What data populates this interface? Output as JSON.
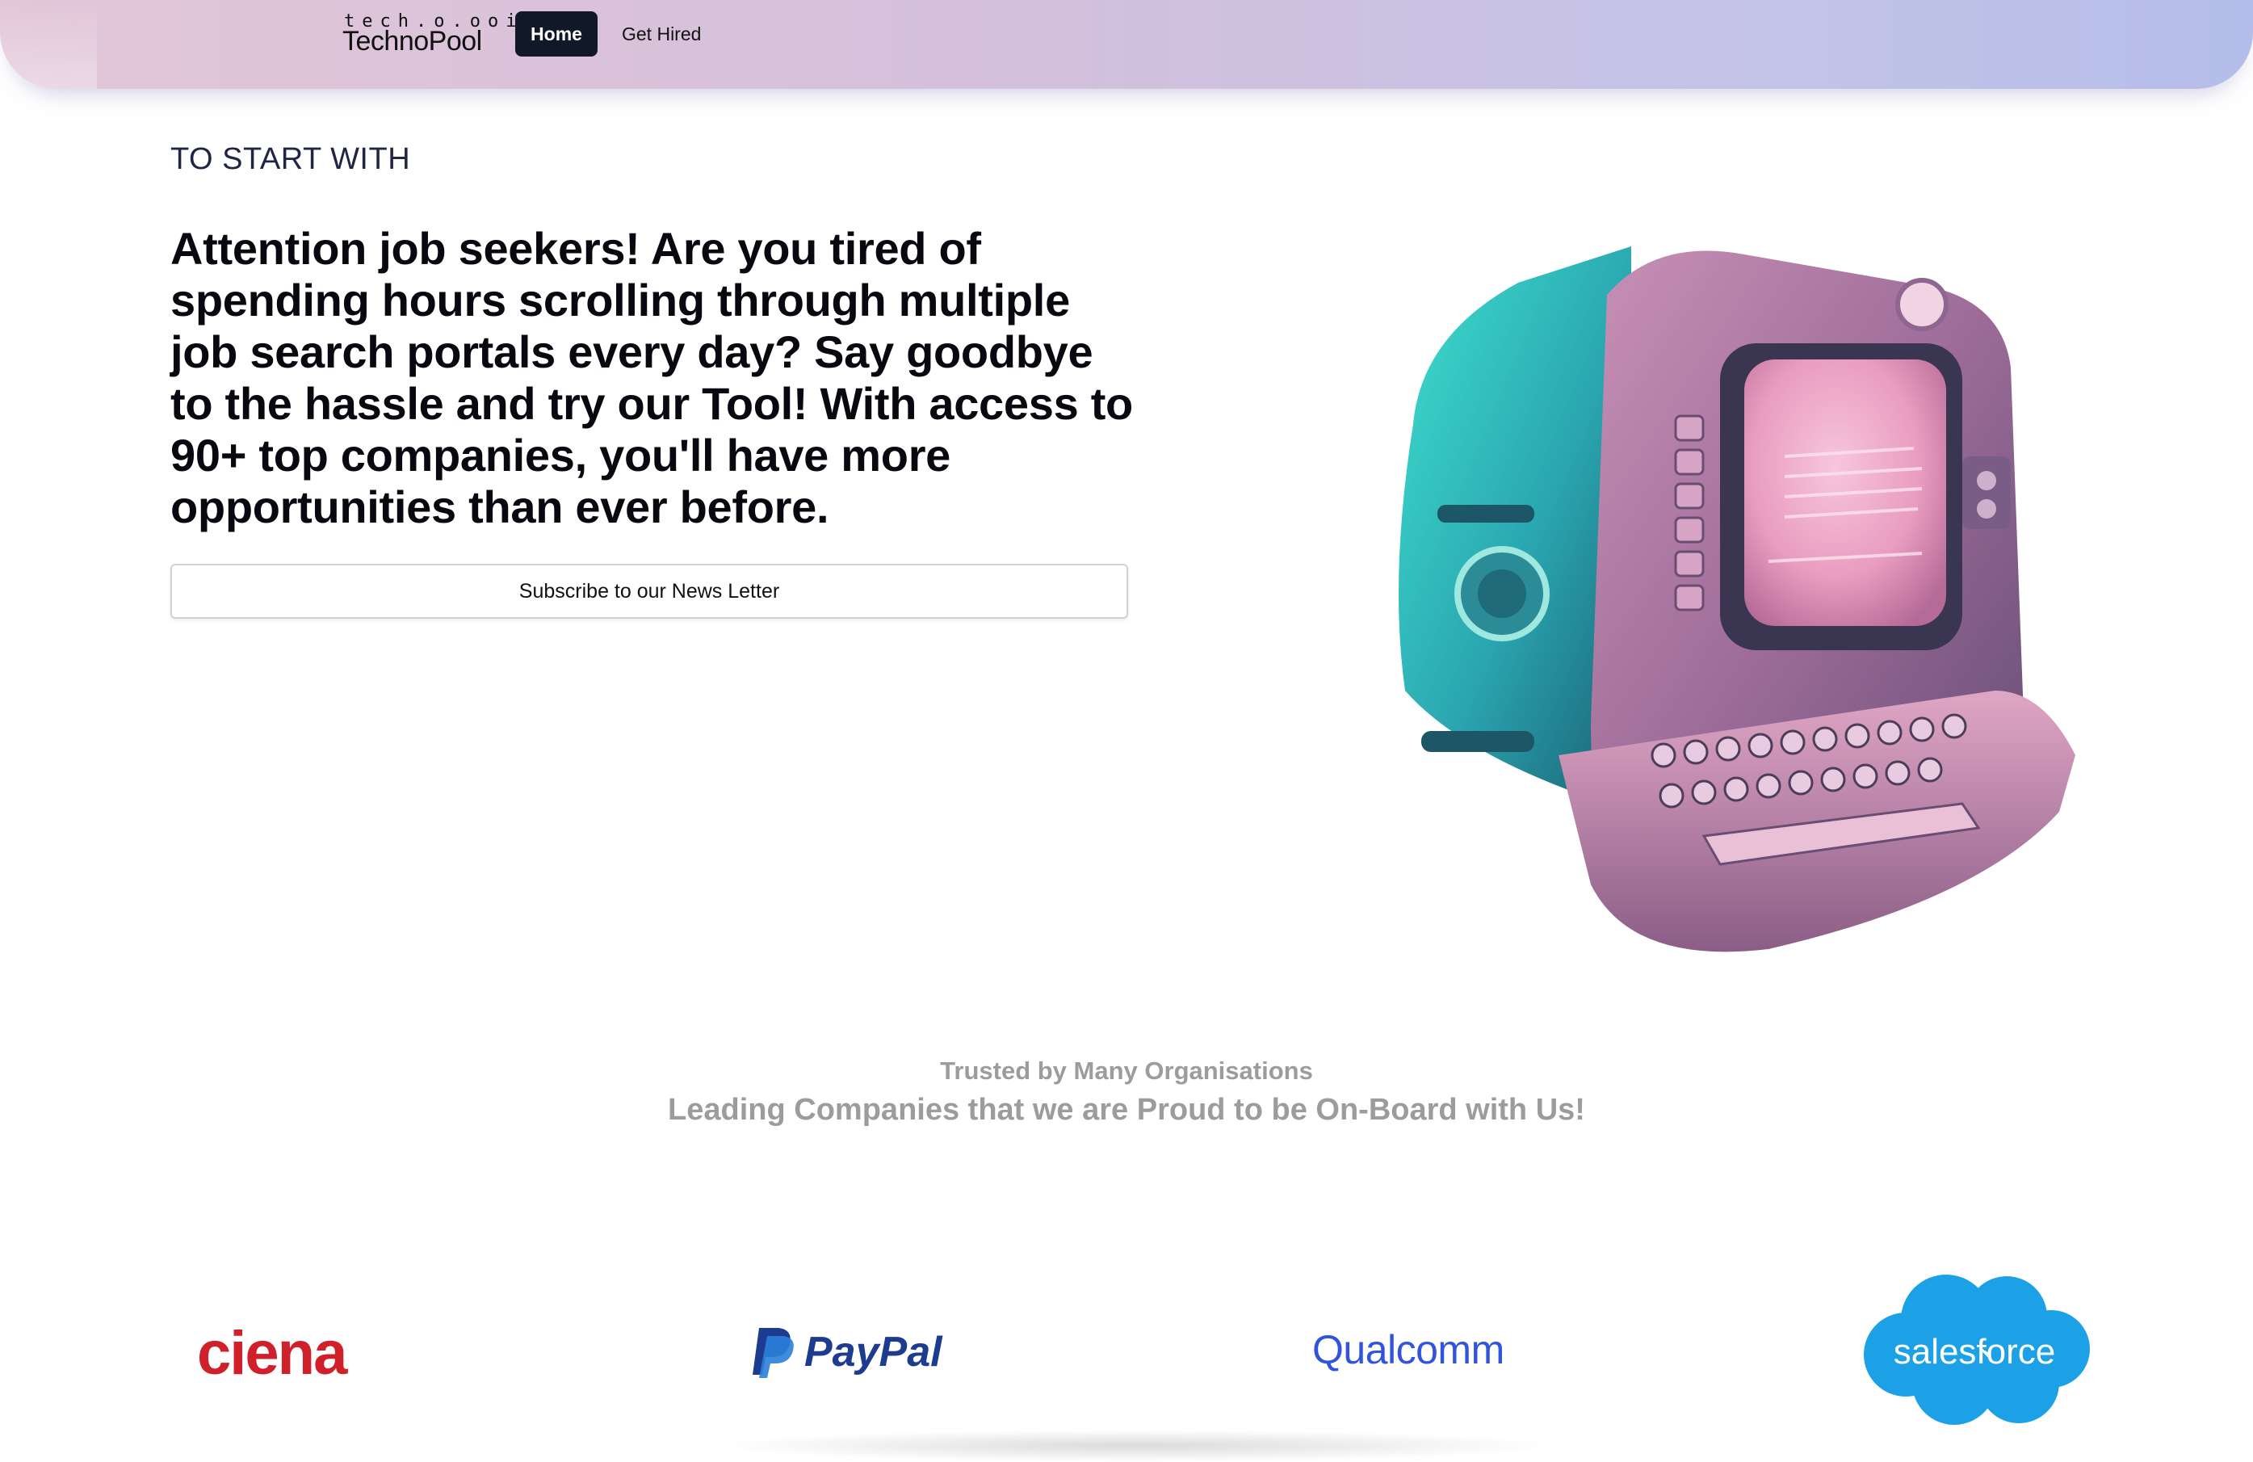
{
  "header": {
    "logo_top": "tech.o.ooi",
    "logo_main": "TechnoPool",
    "nav": [
      {
        "label": "Home",
        "active": true
      },
      {
        "label": "Get Hired",
        "active": false
      }
    ]
  },
  "hero": {
    "eyebrow": "TO START WITH",
    "headline": "Attention job seekers! Are you tired of spending hours scrolling through multiple job search portals every day? Say goodbye to the hassle and try our Tool! With access to 90+ top companies, you'll have more opportunities than ever before.",
    "subscribe_label": "Subscribe to our News Letter",
    "illustration": "retro-computer-illustration"
  },
  "trusted": {
    "line1": "Trusted by Many Organisations",
    "line2": "Leading Companies that we are Proud to be On-Board with Us!"
  },
  "partners": {
    "ciena": "ciena",
    "paypal": "PayPal",
    "qualcomm": "Qualcomm",
    "salesforce": "salesforce"
  },
  "colors": {
    "nav_active_bg": "#111827",
    "ciena_red": "#d0202a",
    "paypal_blue": "#1d3b8f",
    "qualcomm_blue": "#3253dc",
    "salesforce_blue": "#1ca1e6",
    "muted_text": "#9c9c9c"
  }
}
